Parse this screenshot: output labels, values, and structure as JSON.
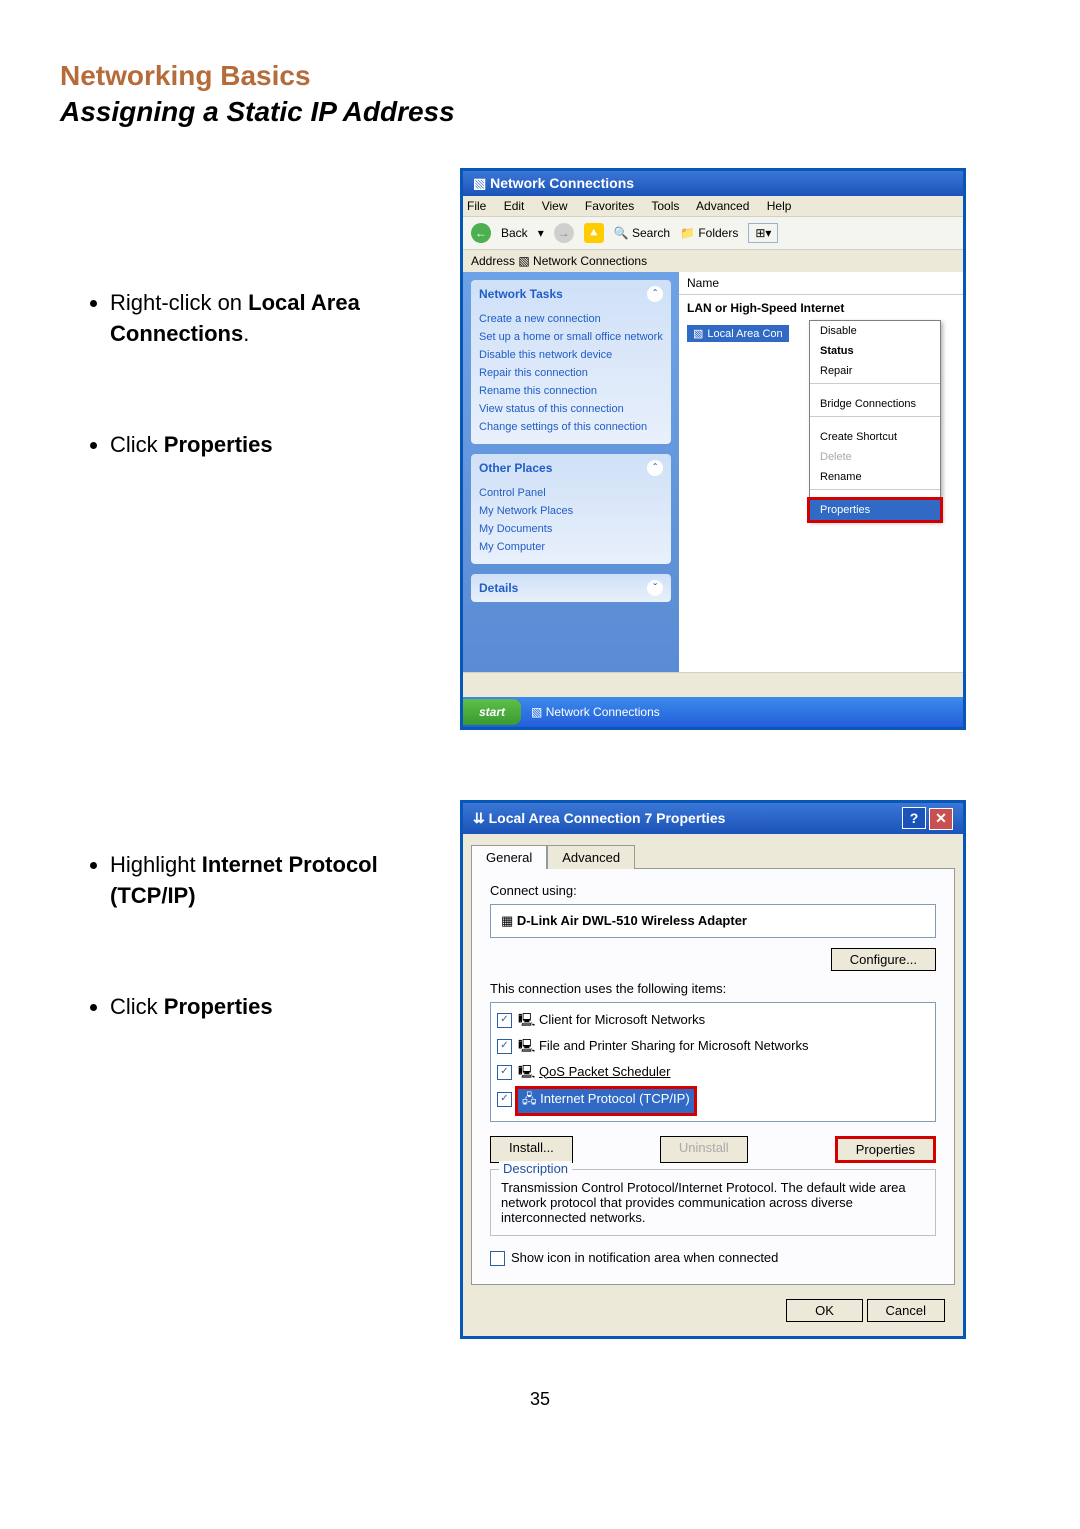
{
  "heading": {
    "title": "Networking Basics",
    "subtitle": "Assigning a Static IP Address"
  },
  "steps1": [
    "Right-click on <b>Local Area Connections</b>.",
    "Click <b>Properties</b>"
  ],
  "steps2": [
    "Highlight <b>Internet Protocol (TCP/IP)</b>",
    "Click <b>Properties</b>"
  ],
  "win1": {
    "title": "Network Connections",
    "menus": [
      "File",
      "Edit",
      "View",
      "Favorites",
      "Tools",
      "Advanced",
      "Help"
    ],
    "toolbar": {
      "back": "Back",
      "search": "Search",
      "folders": "Folders"
    },
    "address": {
      "label": "Address",
      "value": "Network Connections"
    },
    "tasks": {
      "header": "Network Tasks",
      "items": [
        "Create a new connection",
        "Set up a home or small office network",
        "Disable this network device",
        "Repair this connection",
        "Rename this connection",
        "View status of this connection",
        "Change settings of this connection"
      ]
    },
    "places": {
      "header": "Other Places",
      "items": [
        "Control Panel",
        "My Network Places",
        "My Documents",
        "My Computer"
      ]
    },
    "details": {
      "header": "Details"
    },
    "list": {
      "col": "Name",
      "group": "LAN or High-Speed Internet",
      "item": "Local Area Con"
    },
    "context": [
      "Disable",
      "Status",
      "Repair",
      "Bridge Connections",
      "Create Shortcut",
      "Delete",
      "Rename",
      "Properties"
    ],
    "start": "start",
    "taskItem": "Network Connections"
  },
  "win2": {
    "title": "Local Area Connection 7 Properties",
    "tabs": [
      "General",
      "Advanced"
    ],
    "connectUsing": {
      "label": "Connect using:",
      "value": "D-Link Air DWL-510 Wireless Adapter",
      "configure": "Configure..."
    },
    "itemsLabel": "This connection uses the following items:",
    "items": [
      "Client for Microsoft Networks",
      "File and Printer Sharing for Microsoft Networks",
      "QoS Packet Scheduler",
      "Internet Protocol (TCP/IP)"
    ],
    "buttons": {
      "install": "Install...",
      "uninstall": "Uninstall",
      "properties": "Properties"
    },
    "desc": {
      "legend": "Description",
      "text": "Transmission Control Protocol/Internet Protocol. The default wide area network protocol that provides communication across diverse interconnected networks."
    },
    "showIcon": "Show icon in notification area when connected",
    "ok": "OK",
    "cancel": "Cancel"
  },
  "page": "35"
}
